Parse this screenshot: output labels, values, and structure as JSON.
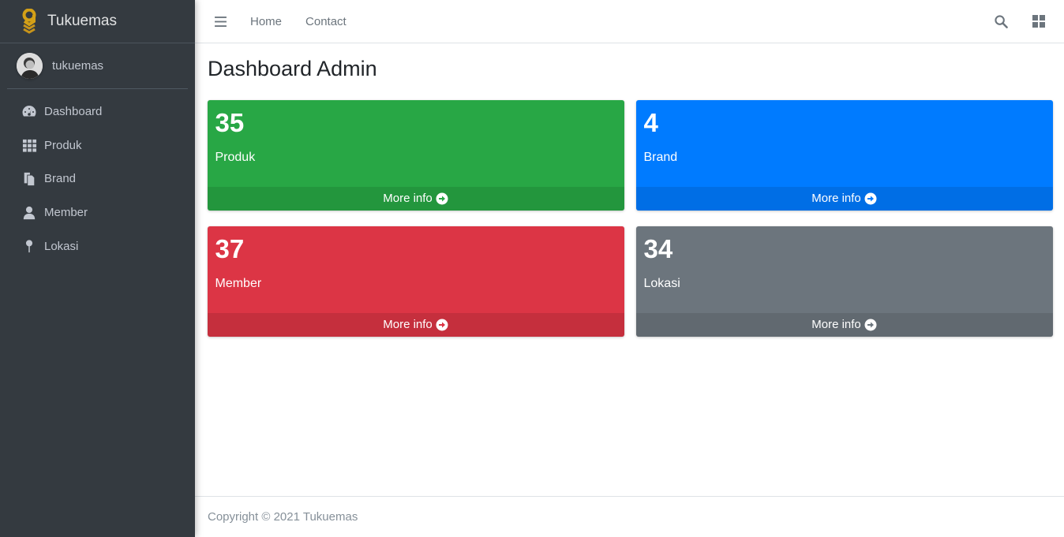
{
  "sidebar": {
    "brand": "Tukuemas",
    "user": "tukuemas",
    "items": [
      {
        "label": "Dashboard",
        "icon": "tachometer-icon"
      },
      {
        "label": "Produk",
        "icon": "grid-icon"
      },
      {
        "label": "Brand",
        "icon": "copy-icon"
      },
      {
        "label": "Member",
        "icon": "user-icon"
      },
      {
        "label": "Lokasi",
        "icon": "map-pin-icon"
      }
    ]
  },
  "navbar": {
    "links": [
      "Home",
      "Contact"
    ],
    "right_icons": [
      "search-icon",
      "th-large-icon"
    ]
  },
  "page": {
    "title": "Dashboard Admin"
  },
  "boxes": [
    {
      "count": "35",
      "label": "Produk",
      "more": "More info",
      "color": "#28a745"
    },
    {
      "count": "4",
      "label": "Brand",
      "more": "More info",
      "color": "#007bff"
    },
    {
      "count": "37",
      "label": "Member",
      "more": "More info",
      "color": "#dc3545"
    },
    {
      "count": "34",
      "label": "Lokasi",
      "more": "More info",
      "color": "#6c757d"
    }
  ],
  "footer": {
    "copyright": "Copyright © 2021 Tukuemas"
  }
}
